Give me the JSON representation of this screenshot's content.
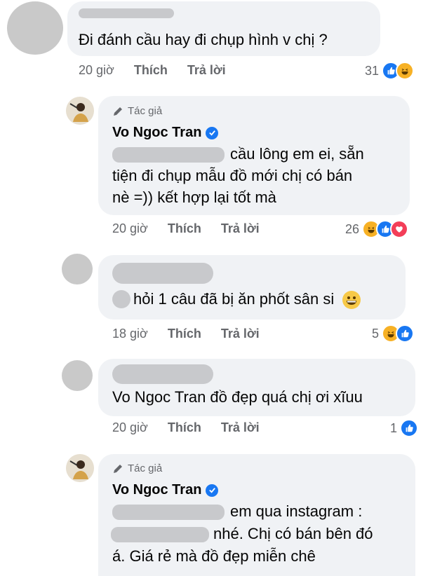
{
  "comments": [
    {
      "text_lines": [
        "Đi đánh cầu hay đi chụp hình v chị ?"
      ],
      "time": "20 giờ",
      "like_label": "Thích",
      "reply_label": "Trả lời",
      "reaction_count": "31",
      "reactions": [
        "like-icon",
        "haha-icon"
      ]
    },
    {
      "author_tag": "Tác giả",
      "author_name": "Vo Ngoc Tran",
      "text_lines": [
        "cầu lông em ei, sẵn",
        "tiện đi chụp mẫu đồ mới chị có bán",
        "nè =)) kết hợp lại tốt mà"
      ],
      "time": "20 giờ",
      "like_label": "Thích",
      "reply_label": "Trả lời",
      "reaction_count": "26",
      "reactions": [
        "haha-icon",
        "like-icon",
        "love-icon"
      ]
    },
    {
      "text_lines": [
        "hỏi 1 câu đã bị ăn phốt sân si"
      ],
      "time": "18 giờ",
      "like_label": "Thích",
      "reply_label": "Trả lời",
      "reaction_count": "5",
      "reactions": [
        "haha-icon",
        "like-icon"
      ]
    },
    {
      "text_lines": [
        "Vo Ngoc Tran đồ đẹp quá chị ơi xĩuu"
      ],
      "time": "20 giờ",
      "like_label": "Thích",
      "reply_label": "Trả lời",
      "reaction_count": "1",
      "reactions": [
        "like-icon"
      ]
    },
    {
      "author_tag": "Tác giả",
      "author_name": "Vo Ngoc Tran",
      "text_lines": [
        "em qua instagram :",
        "nhé. Chị có bán bên đó",
        "á. Giá rẻ mà đồ đẹp miễn chê"
      ]
    }
  ],
  "colors": {
    "bubble": "#f0f2f5",
    "meta": "#65676b",
    "like": "#1877f2",
    "love": "#f33e58",
    "haha": "#f7b125"
  }
}
